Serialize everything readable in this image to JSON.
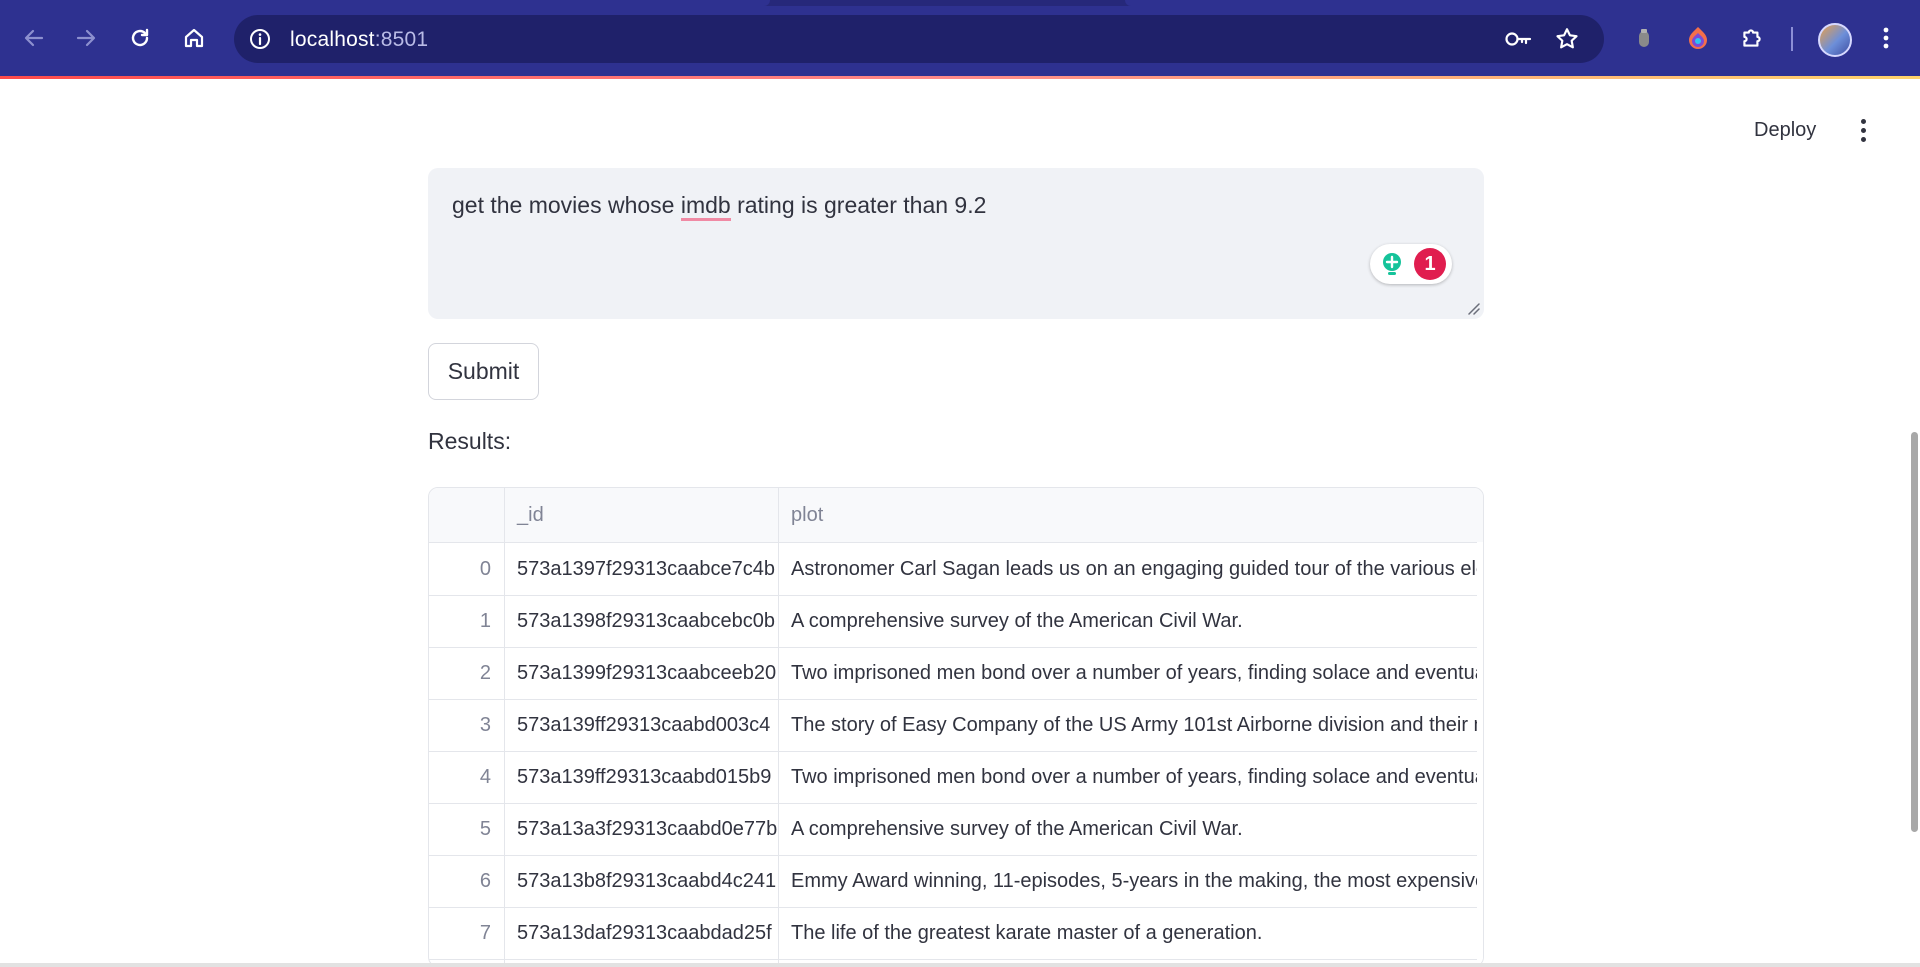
{
  "browser": {
    "url_host": "localhost",
    "url_port": ":8501",
    "icons": [
      "back-icon",
      "forward-icon",
      "reload-icon",
      "home-icon",
      "site-info-icon",
      "password-key-icon",
      "bookmark-star-icon",
      "extension-icon",
      "extensions-puzzle-icon",
      "profile-avatar",
      "menu-kebab-icon"
    ]
  },
  "header": {
    "deploy_label": "Deploy"
  },
  "query": {
    "text_before": "get the movies whose ",
    "text_flagged": "imdb",
    "text_after": " rating is greater than 9.2",
    "grammarly_count": "1"
  },
  "submit_label": "Submit",
  "results_label": "Results:",
  "table": {
    "columns": [
      "",
      "_id",
      "plot"
    ],
    "rows": [
      {
        "index": "0",
        "id": "573a1397f29313caabce7c4b",
        "plot": "Astronomer Carl Sagan leads us on an engaging guided tour of the various elen"
      },
      {
        "index": "1",
        "id": "573a1398f29313caabcebc0b",
        "plot": "A comprehensive survey of the American Civil War."
      },
      {
        "index": "2",
        "id": "573a1399f29313caabceeb20",
        "plot": "Two imprisoned men bond over a number of years, finding solace and eventua"
      },
      {
        "index": "3",
        "id": "573a139ff29313caabd003c4",
        "plot": "The story of Easy Company of the US Army 101st Airborne division and their mi"
      },
      {
        "index": "4",
        "id": "573a139ff29313caabd015b9",
        "plot": "Two imprisoned men bond over a number of years, finding solace and eventua"
      },
      {
        "index": "5",
        "id": "573a13a3f29313caabd0e77b",
        "plot": "A comprehensive survey of the American Civil War."
      },
      {
        "index": "6",
        "id": "573a13b8f29313caabd4c241",
        "plot": "Emmy Award winning, 11-episodes, 5-years in the making, the most expensive"
      },
      {
        "index": "7",
        "id": "573a13daf29313caabdad25f",
        "plot": "The life of the greatest karate master of a generation."
      }
    ]
  },
  "colors": {
    "chrome": "#2e3190",
    "omnibox": "#1f216a",
    "textarea_bg": "#f0f2f6",
    "grammarly_badge": "#e01d4f",
    "grammarly_bulb": "#15c39a"
  }
}
